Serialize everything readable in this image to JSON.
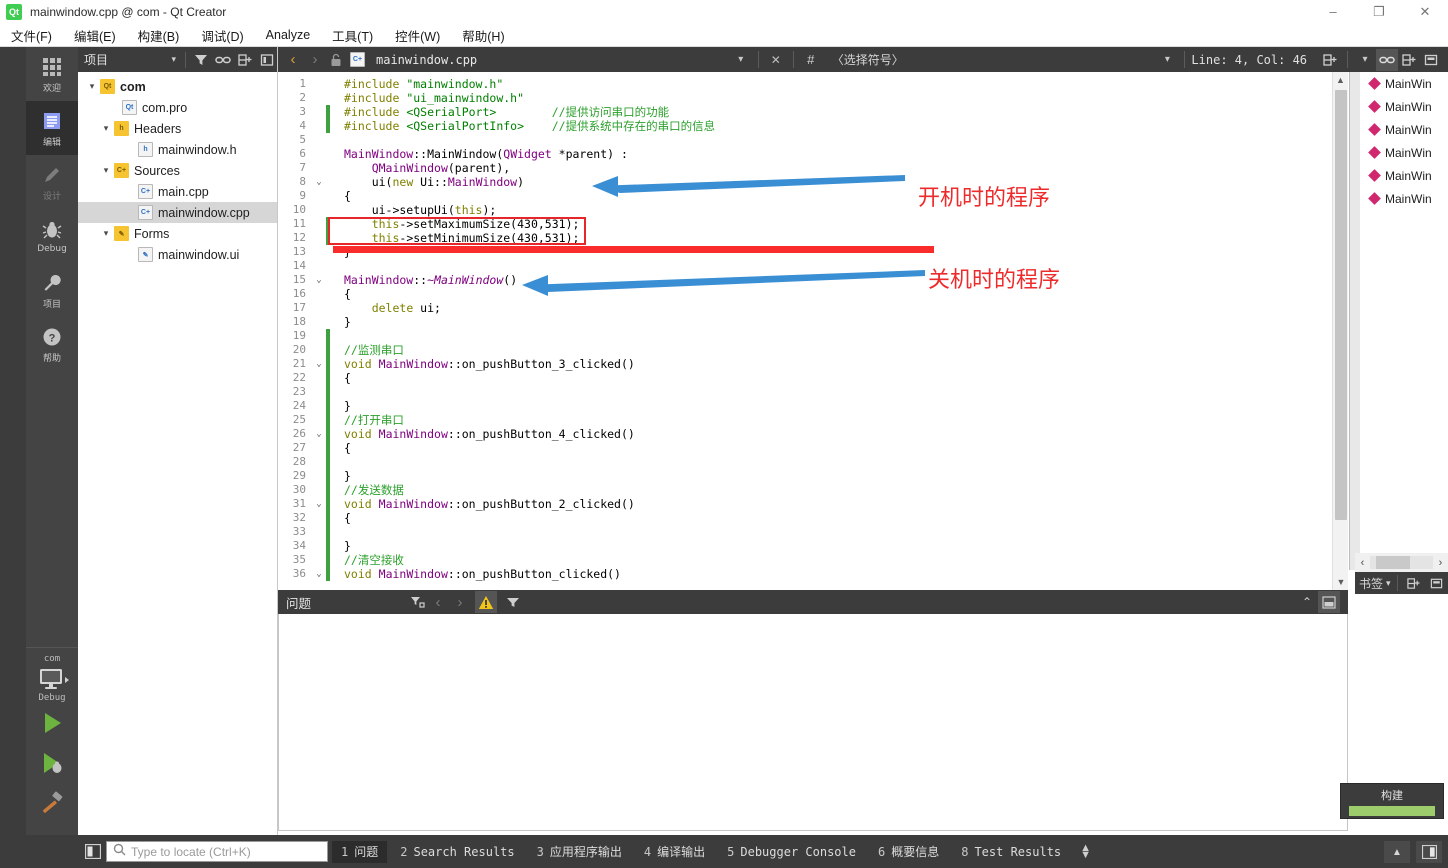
{
  "window": {
    "title": "mainwindow.cpp @ com - Qt Creator",
    "logo": "qt-logo-icon",
    "minimize": "–",
    "maximize": "❐",
    "close": "✕"
  },
  "menubar": [
    {
      "label": "文件(F)",
      "name": "menu-file"
    },
    {
      "label": "编辑(E)",
      "name": "menu-edit"
    },
    {
      "label": "构建(B)",
      "name": "menu-build"
    },
    {
      "label": "调试(D)",
      "name": "menu-debug"
    },
    {
      "label": "Analyze",
      "name": "menu-analyze"
    },
    {
      "label": "工具(T)",
      "name": "menu-tools"
    },
    {
      "label": "控件(W)",
      "name": "menu-widgets"
    },
    {
      "label": "帮助(H)",
      "name": "menu-help"
    }
  ],
  "modebar": [
    {
      "label": "欢迎",
      "icon": "grid-icon",
      "active": false
    },
    {
      "label": "编辑",
      "icon": "document-icon",
      "active": true
    },
    {
      "label": "设计",
      "icon": "pencil-icon",
      "active": false
    },
    {
      "label": "Debug",
      "icon": "bug-icon",
      "active": false
    },
    {
      "label": "项目",
      "icon": "wrench-icon",
      "active": false
    },
    {
      "label": "帮助",
      "icon": "question-icon",
      "active": false
    }
  ],
  "runpanel": {
    "project": "com",
    "kit_icon": "desktop-monitor-icon",
    "build_config": "Debug",
    "run_button": "run-icon",
    "debug_button": "debug-run-icon",
    "build_button": "hammer-icon"
  },
  "sidebar": {
    "title": "项目",
    "toolbar_icons": [
      "filter-icon",
      "link-icon",
      "split-icon",
      "close-split-icon"
    ],
    "tree": [
      {
        "label": "com",
        "depth": 0,
        "icon": "qt-project-icon",
        "expander": "⌄",
        "bold": true,
        "selected": false
      },
      {
        "label": "com.pro",
        "depth": 1,
        "icon": "qt-pro-file-icon",
        "expander": "",
        "bold": false,
        "selected": false
      },
      {
        "label": "Headers",
        "depth": 1,
        "icon": "headers-folder-icon",
        "expander": "⌄",
        "bold": false,
        "selected": false
      },
      {
        "label": "mainwindow.h",
        "depth": 2,
        "icon": "h-file-icon",
        "expander": "",
        "bold": false,
        "selected": false
      },
      {
        "label": "Sources",
        "depth": 1,
        "icon": "sources-folder-icon",
        "expander": "⌄",
        "bold": false,
        "selected": false
      },
      {
        "label": "main.cpp",
        "depth": 2,
        "icon": "cpp-file-icon",
        "expander": "",
        "bold": false,
        "selected": false
      },
      {
        "label": "mainwindow.cpp",
        "depth": 2,
        "icon": "cpp-file-icon",
        "expander": "",
        "bold": false,
        "selected": true
      },
      {
        "label": "Forms",
        "depth": 1,
        "icon": "forms-folder-icon",
        "expander": "⌄",
        "bold": false,
        "selected": false
      },
      {
        "label": "mainwindow.ui",
        "depth": 2,
        "icon": "ui-file-icon",
        "expander": "",
        "bold": false,
        "selected": false
      }
    ]
  },
  "editor_toolbar": {
    "back": "‹",
    "forward": "›",
    "lock_icon": "unlocked-icon",
    "file_icon": "cpp-file-icon",
    "filename": "mainwindow.cpp",
    "dropdown": "▾",
    "close": "✕",
    "hash": "#",
    "symbol_selector": "〈选择符号〉",
    "line_col": "Line: 4, Col: 46",
    "split_icon": "split-icon",
    "sync_icon": "link-icon",
    "add_split_icon": "split-add-icon",
    "close_split_icon": "close-split-icon"
  },
  "code": {
    "lines": [
      {
        "n": 1,
        "fold": "",
        "chg": false,
        "tokens": [
          {
            "t": "#include ",
            "c": "pre"
          },
          {
            "t": "\"mainwindow.h\"",
            "c": "str"
          }
        ]
      },
      {
        "n": 2,
        "fold": "",
        "chg": false,
        "tokens": [
          {
            "t": "#include ",
            "c": "pre"
          },
          {
            "t": "\"ui_mainwindow.h\"",
            "c": "str"
          }
        ]
      },
      {
        "n": 3,
        "fold": "",
        "chg": true,
        "tokens": [
          {
            "t": "#include ",
            "c": "pre"
          },
          {
            "t": "<QSerialPort>",
            "c": "str"
          },
          {
            "t": "        ",
            "c": "plain"
          },
          {
            "t": "//提供访问串口的功能",
            "c": "cmt"
          }
        ]
      },
      {
        "n": 4,
        "fold": "",
        "chg": true,
        "tokens": [
          {
            "t": "#include ",
            "c": "pre"
          },
          {
            "t": "<QSerialPortInfo>",
            "c": "str"
          },
          {
            "t": "    ",
            "c": "plain"
          },
          {
            "t": "//提供系统中存在的串口的信息",
            "c": "cmt"
          }
        ]
      },
      {
        "n": 5,
        "fold": "",
        "chg": false,
        "tokens": []
      },
      {
        "n": 6,
        "fold": "",
        "chg": false,
        "tokens": [
          {
            "t": "MainWindow",
            "c": "type"
          },
          {
            "t": "::MainWindow(",
            "c": "plain"
          },
          {
            "t": "QWidget",
            "c": "type"
          },
          {
            "t": " *parent) :",
            "c": "plain"
          }
        ]
      },
      {
        "n": 7,
        "fold": "",
        "chg": false,
        "tokens": [
          {
            "t": "    ",
            "c": "plain"
          },
          {
            "t": "QMainWindow",
            "c": "type"
          },
          {
            "t": "(parent),",
            "c": "plain"
          }
        ]
      },
      {
        "n": 8,
        "fold": "⌄",
        "chg": false,
        "tokens": [
          {
            "t": "    ui(",
            "c": "plain"
          },
          {
            "t": "new",
            "c": "kw"
          },
          {
            "t": " Ui::",
            "c": "plain"
          },
          {
            "t": "MainWindow",
            "c": "type"
          },
          {
            "t": ")",
            "c": "plain"
          }
        ]
      },
      {
        "n": 9,
        "fold": "",
        "chg": false,
        "tokens": [
          {
            "t": "{",
            "c": "plain"
          }
        ]
      },
      {
        "n": 10,
        "fold": "",
        "chg": false,
        "tokens": [
          {
            "t": "    ui->setupUi(",
            "c": "plain"
          },
          {
            "t": "this",
            "c": "kw"
          },
          {
            "t": ");",
            "c": "plain"
          }
        ]
      },
      {
        "n": 11,
        "fold": "",
        "chg": true,
        "tokens": [
          {
            "t": "    ",
            "c": "plain"
          },
          {
            "t": "this",
            "c": "kw"
          },
          {
            "t": "->setMaximumSize(430,531);",
            "c": "plain"
          }
        ]
      },
      {
        "n": 12,
        "fold": "",
        "chg": true,
        "tokens": [
          {
            "t": "    ",
            "c": "plain"
          },
          {
            "t": "this",
            "c": "kw"
          },
          {
            "t": "->setMinimumSize(430,531);",
            "c": "plain"
          }
        ]
      },
      {
        "n": 13,
        "fold": "",
        "chg": false,
        "tokens": [
          {
            "t": "}",
            "c": "plain"
          }
        ]
      },
      {
        "n": 14,
        "fold": "",
        "chg": false,
        "tokens": []
      },
      {
        "n": 15,
        "fold": "⌄",
        "chg": false,
        "tokens": [
          {
            "t": "MainWindow",
            "c": "type"
          },
          {
            "t": "::",
            "c": "plain"
          },
          {
            "t": "~MainWindow",
            "c": "ital"
          },
          {
            "t": "()",
            "c": "plain"
          }
        ]
      },
      {
        "n": 16,
        "fold": "",
        "chg": false,
        "tokens": [
          {
            "t": "{",
            "c": "plain"
          }
        ]
      },
      {
        "n": 17,
        "fold": "",
        "chg": false,
        "tokens": [
          {
            "t": "    ",
            "c": "plain"
          },
          {
            "t": "delete",
            "c": "kw"
          },
          {
            "t": " ui;",
            "c": "plain"
          }
        ]
      },
      {
        "n": 18,
        "fold": "",
        "chg": false,
        "tokens": [
          {
            "t": "}",
            "c": "plain"
          }
        ]
      },
      {
        "n": 19,
        "fold": "",
        "chg": true,
        "tokens": []
      },
      {
        "n": 20,
        "fold": "",
        "chg": true,
        "tokens": [
          {
            "t": "//监测串口",
            "c": "cmt"
          }
        ]
      },
      {
        "n": 21,
        "fold": "⌄",
        "chg": true,
        "tokens": [
          {
            "t": "void",
            "c": "kw"
          },
          {
            "t": " ",
            "c": "plain"
          },
          {
            "t": "MainWindow",
            "c": "type"
          },
          {
            "t": "::on_pushButton_3_clicked()",
            "c": "plain"
          }
        ]
      },
      {
        "n": 22,
        "fold": "",
        "chg": true,
        "tokens": [
          {
            "t": "{",
            "c": "plain"
          }
        ]
      },
      {
        "n": 23,
        "fold": "",
        "chg": true,
        "tokens": []
      },
      {
        "n": 24,
        "fold": "",
        "chg": true,
        "tokens": [
          {
            "t": "}",
            "c": "plain"
          }
        ]
      },
      {
        "n": 25,
        "fold": "",
        "chg": true,
        "tokens": [
          {
            "t": "//打开串口",
            "c": "cmt"
          }
        ]
      },
      {
        "n": 26,
        "fold": "⌄",
        "chg": true,
        "tokens": [
          {
            "t": "void",
            "c": "kw"
          },
          {
            "t": " ",
            "c": "plain"
          },
          {
            "t": "MainWindow",
            "c": "type"
          },
          {
            "t": "::on_pushButton_4_clicked()",
            "c": "plain"
          }
        ]
      },
      {
        "n": 27,
        "fold": "",
        "chg": true,
        "tokens": [
          {
            "t": "{",
            "c": "plain"
          }
        ]
      },
      {
        "n": 28,
        "fold": "",
        "chg": true,
        "tokens": []
      },
      {
        "n": 29,
        "fold": "",
        "chg": true,
        "tokens": [
          {
            "t": "}",
            "c": "plain"
          }
        ]
      },
      {
        "n": 30,
        "fold": "",
        "chg": true,
        "tokens": [
          {
            "t": "//发送数据",
            "c": "cmt"
          }
        ]
      },
      {
        "n": 31,
        "fold": "⌄",
        "chg": true,
        "tokens": [
          {
            "t": "void",
            "c": "kw"
          },
          {
            "t": " ",
            "c": "plain"
          },
          {
            "t": "MainWindow",
            "c": "type"
          },
          {
            "t": "::on_pushButton_2_clicked()",
            "c": "plain"
          }
        ]
      },
      {
        "n": 32,
        "fold": "",
        "chg": true,
        "tokens": [
          {
            "t": "{",
            "c": "plain"
          }
        ]
      },
      {
        "n": 33,
        "fold": "",
        "chg": true,
        "tokens": []
      },
      {
        "n": 34,
        "fold": "",
        "chg": true,
        "tokens": [
          {
            "t": "}",
            "c": "plain"
          }
        ]
      },
      {
        "n": 35,
        "fold": "",
        "chg": true,
        "tokens": [
          {
            "t": "//清空接收",
            "c": "cmt"
          }
        ]
      },
      {
        "n": 36,
        "fold": "⌄",
        "chg": true,
        "tokens": [
          {
            "t": "void",
            "c": "kw"
          },
          {
            "t": " ",
            "c": "plain"
          },
          {
            "t": "MainWindow",
            "c": "type"
          },
          {
            "t": "::on_pushButton_clicked()",
            "c": "plain"
          }
        ]
      }
    ]
  },
  "annotations": [
    {
      "text": "开机时的程序",
      "name": "annotation-startup",
      "color": "#ee2b2b"
    },
    {
      "text": "关机时的程序",
      "name": "annotation-shutdown",
      "color": "#ee2b2b"
    }
  ],
  "highlight": {
    "box_color": "#e8262a",
    "bar_color": "#fa2b2b"
  },
  "arrows": {
    "color": "#3a8fd4"
  },
  "outline": {
    "items": [
      {
        "label": "MainWin"
      },
      {
        "label": "MainWin"
      },
      {
        "label": "MainWin"
      },
      {
        "label": "MainWin"
      },
      {
        "label": "MainWin"
      },
      {
        "label": "MainWin"
      }
    ],
    "bookmark_label": "书签",
    "scroll_left": "‹",
    "scroll_right": "›"
  },
  "issues_panel": {
    "title": "问题",
    "icons": [
      "filter-category-icon",
      "prev-icon",
      "next-icon",
      "warning-icon",
      "filter-icon"
    ],
    "prev": "‹",
    "next": "›",
    "collapse": "⌃",
    "maximize": "▣"
  },
  "statusbar": {
    "split_icon": "sidebar-toggle-icon",
    "search_icon": "search-icon",
    "locator_placeholder": "Type to locate (Ctrl+K)",
    "tabs": [
      {
        "num": "1",
        "label": "问题",
        "active": true
      },
      {
        "num": "2",
        "label": "Search Results",
        "active": false
      },
      {
        "num": "3",
        "label": "应用程序输出",
        "active": false
      },
      {
        "num": "4",
        "label": "编译输出",
        "active": false
      },
      {
        "num": "5",
        "label": "Debugger Console",
        "active": false
      },
      {
        "num": "6",
        "label": "概要信息",
        "active": false
      },
      {
        "num": "8",
        "label": "Test Results",
        "active": false
      }
    ],
    "updown": "⇅"
  },
  "build_popup": {
    "title": "构建",
    "progress": 100,
    "bar_color": "#9ccc6b"
  }
}
